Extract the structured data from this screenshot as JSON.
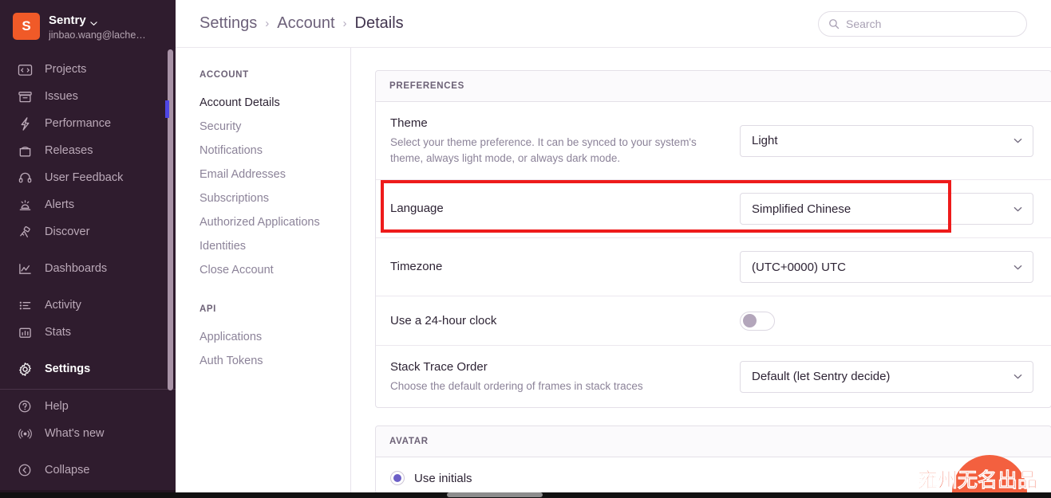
{
  "primary_nav": {
    "org": {
      "avatar_initial": "S",
      "name": "Sentry",
      "email": "jinbao.wang@lache…"
    },
    "items": [
      {
        "label": "Projects",
        "icon": "code-folder-icon"
      },
      {
        "label": "Issues",
        "icon": "archive-icon"
      },
      {
        "label": "Performance",
        "icon": "lightning-icon"
      },
      {
        "label": "Releases",
        "icon": "box-icon"
      },
      {
        "label": "User Feedback",
        "icon": "support-headset-icon"
      },
      {
        "label": "Alerts",
        "icon": "siren-icon"
      },
      {
        "label": "Discover",
        "icon": "telescope-icon"
      },
      {
        "label": "Dashboards",
        "icon": "chart-line-icon"
      },
      {
        "label": "Activity",
        "icon": "list-icon"
      },
      {
        "label": "Stats",
        "icon": "bar-chart-icon"
      },
      {
        "label": "Settings",
        "icon": "gear-icon"
      }
    ],
    "footer_items": [
      {
        "label": "Help",
        "icon": "question-circle-icon"
      },
      {
        "label": "What's new",
        "icon": "broadcast-icon"
      },
      {
        "label": "Collapse",
        "icon": "chevron-left-circle-icon"
      }
    ],
    "active_item": "Settings"
  },
  "header": {
    "breadcrumb": [
      "Settings",
      "Account",
      "Details"
    ],
    "separator": "›",
    "search": {
      "placeholder": "Search",
      "value": "",
      "icon": "search-icon"
    }
  },
  "settings_nav": {
    "groups": [
      {
        "heading": "ACCOUNT",
        "items": [
          "Account Details",
          "Security",
          "Notifications",
          "Email Addresses",
          "Subscriptions",
          "Authorized Applications",
          "Identities",
          "Close Account"
        ]
      },
      {
        "heading": "API",
        "items": [
          "Applications",
          "Auth Tokens"
        ]
      }
    ],
    "active_item": "Account Details"
  },
  "preferences": {
    "panel_title": "PREFERENCES",
    "rows": [
      {
        "label": "Theme",
        "help": "Select your theme preference. It can be synced to your system's theme, always light mode, or always dark mode.",
        "control": "select",
        "value": "Light"
      },
      {
        "label": "Language",
        "help": "",
        "control": "select",
        "value": "Simplified Chinese",
        "highlighted": true
      },
      {
        "label": "Timezone",
        "help": "",
        "control": "select",
        "value": "(UTC+0000) UTC"
      },
      {
        "label": "Use a 24-hour clock",
        "help": "",
        "control": "toggle",
        "value": "off"
      },
      {
        "label": "Stack Trace Order",
        "help": "Choose the default ordering of frames in stack traces",
        "control": "select",
        "value": "Default (let Sentry decide)"
      }
    ]
  },
  "avatar_panel": {
    "panel_title": "AVATAR",
    "options": [
      {
        "label": "Use initials",
        "selected": true
      }
    ]
  },
  "watermark": {
    "text": "雍州无名出品"
  },
  "colors": {
    "nav_background": "#2f1c2e",
    "org_avatar": "#f05a28",
    "accent_purple": "#6c5fc7",
    "active_indicator": "#4e46e5",
    "highlight_red": "#ee1b1b",
    "watermark_orange": "#f0553a"
  }
}
